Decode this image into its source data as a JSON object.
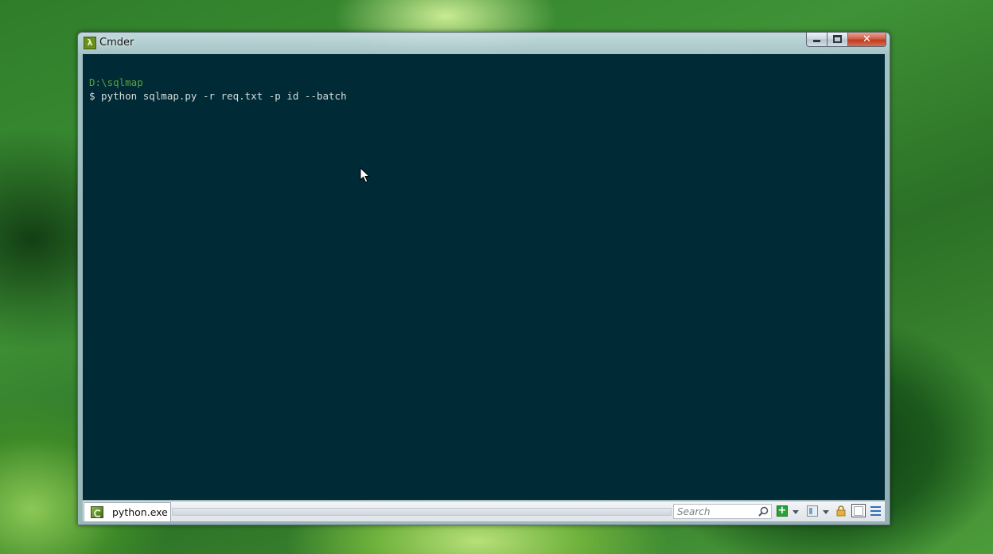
{
  "window": {
    "title": "Cmder",
    "app_icon_glyph": "λ",
    "controls": {
      "minimize_icon": "minimize-icon",
      "maximize_icon": "maximize-icon",
      "close_glyph": "✕"
    }
  },
  "terminal": {
    "background": "#002b36",
    "lines": [
      {
        "text": "D:\\sqlmap",
        "kind": "path",
        "color": "#5aa33c"
      },
      {
        "text": "$ python sqlmap.py -r req.txt -p id --batch",
        "kind": "command",
        "color": "#d7dcdc"
      }
    ]
  },
  "statusbar": {
    "active_tab": "python.exe",
    "search_placeholder": "Search",
    "icons": [
      "add-console-icon",
      "split-icon",
      "lock-icon",
      "view-icon",
      "menu-icon"
    ]
  },
  "colors": {
    "close_button": "#c9452b",
    "accent_green": "#27a33a",
    "menu_blue": "#2f6fb8"
  }
}
